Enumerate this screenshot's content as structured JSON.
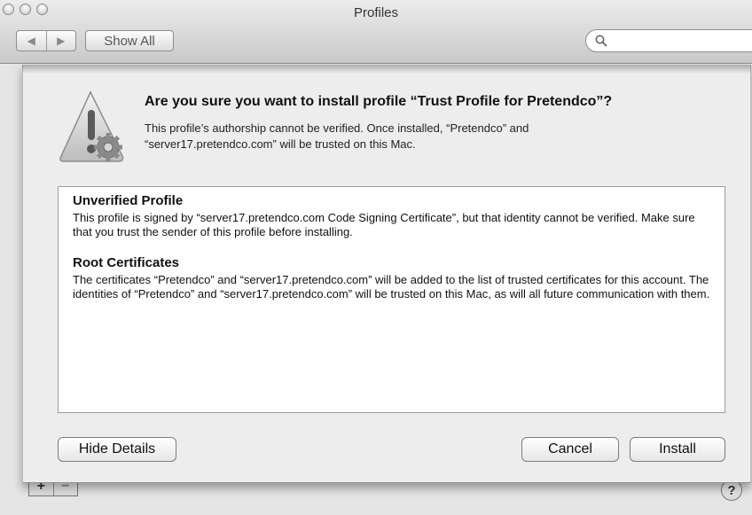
{
  "window": {
    "title": "Profiles",
    "show_all_label": "Show All",
    "back_glyph": "◀",
    "forward_glyph": "▶",
    "search_placeholder": ""
  },
  "dialog": {
    "heading": "Are you sure you want to install profile “Trust Profile for Pretendco”?",
    "message_line1": "This profile’s authorship cannot be verified. Once installed, “Pretendco” and",
    "message_line2": "“server17.pretendco.com” will be trusted on this Mac.",
    "icon": "warning-icon",
    "sections": [
      {
        "title": "Unverified Profile",
        "body": "This profile is signed by “server17.pretendco.com Code Signing Certificate”, but that identity cannot be verified. Make sure that you trust the sender of this profile before installing."
      },
      {
        "title": "Root Certificates",
        "body": "The certificates “Pretendco” and “server17.pretendco.com” will be added to the list of trusted certificates for this account. The identities of “Pretendco” and “server17.pretendco.com” will be trusted on this Mac, as will all future communication with them."
      }
    ],
    "buttons": {
      "hide_details": "Hide Details",
      "cancel": "Cancel",
      "install": "Install"
    }
  },
  "footer": {
    "add_label": "+",
    "remove_label": "−",
    "help_label": "?"
  }
}
